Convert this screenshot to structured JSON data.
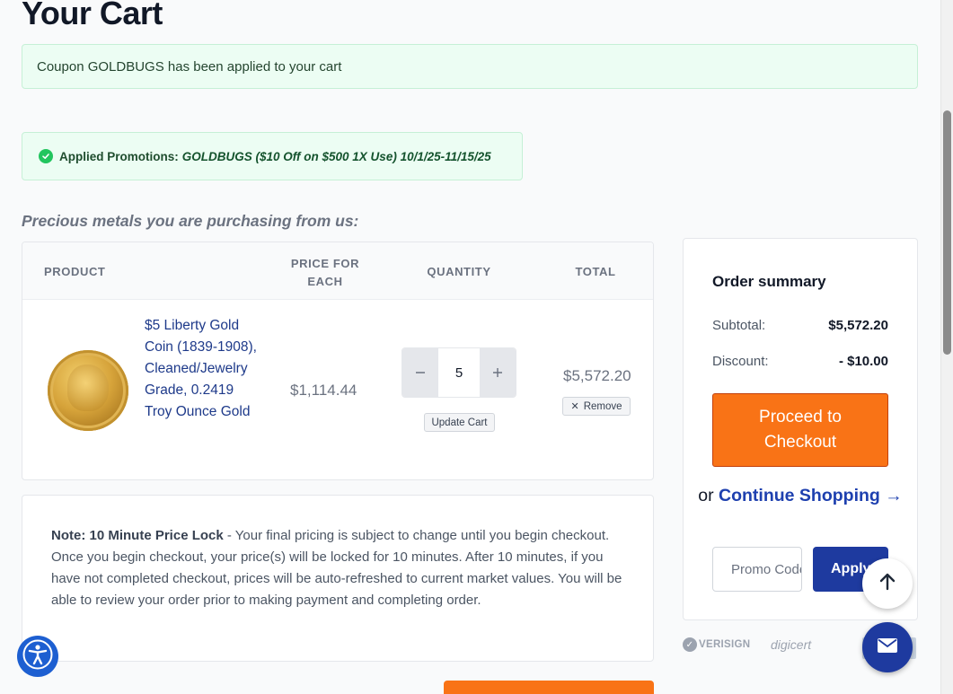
{
  "page": {
    "title": "Your Cart"
  },
  "coupon_message": "Coupon GOLDBUGS has been applied to your cart",
  "promotions": {
    "label": "Applied Promotions:",
    "value": "GOLDBUGS ($10 Off on $500 1X Use) 10/1/25-11/15/25"
  },
  "cart": {
    "subheading": "Precious metals you are purchasing from us:",
    "columns": {
      "product": "PRODUCT",
      "price": "PRICE FOR EACH",
      "quantity": "QUANTITY",
      "total": "TOTAL"
    },
    "items": [
      {
        "name": "$5 Liberty Gold Coin (1839-1908), Cleaned/Jewelry Grade, 0.2419 Troy Ounce Gold",
        "price_each": "$1,114.44",
        "quantity": "5",
        "line_total": "$5,572.20",
        "update_label": "Update Cart",
        "remove_label": "Remove"
      }
    ]
  },
  "note": {
    "bold": "Note: 10 Minute Price Lock",
    "text": " - Your final pricing is subject to change until you begin checkout. Once you begin checkout, your price(s) will be locked for 10 minutes. After 10 minutes, if you have not completed checkout, prices will be auto-refreshed to current market values. You will be able to review your order prior to making payment and completing order."
  },
  "summary": {
    "title": "Order summary",
    "subtotal_label": "Subtotal:",
    "subtotal_value": "$5,572.20",
    "discount_label": "Discount:",
    "discount_value": "- $10.00",
    "checkout_label": "Proceed to Checkout",
    "continue_prefix": "or ",
    "continue_link": "Continue Shopping →",
    "promo_placeholder": "Promo Code",
    "apply_label": "Apply"
  },
  "trust": {
    "verisign": "VERISIGN",
    "digicert": "digicert"
  },
  "icons": {
    "check": "check-circle-icon",
    "minus": "minus-icon",
    "plus": "plus-icon",
    "remove": "close-icon",
    "scroll_top": "arrow-up-icon",
    "mail": "mail-icon",
    "accessibility": "accessibility-icon"
  },
  "colors": {
    "accent_orange": "#f97316",
    "brand_blue": "#1e3a9f",
    "success_bg": "#ecfdf3",
    "success_green": "#22c55e"
  }
}
